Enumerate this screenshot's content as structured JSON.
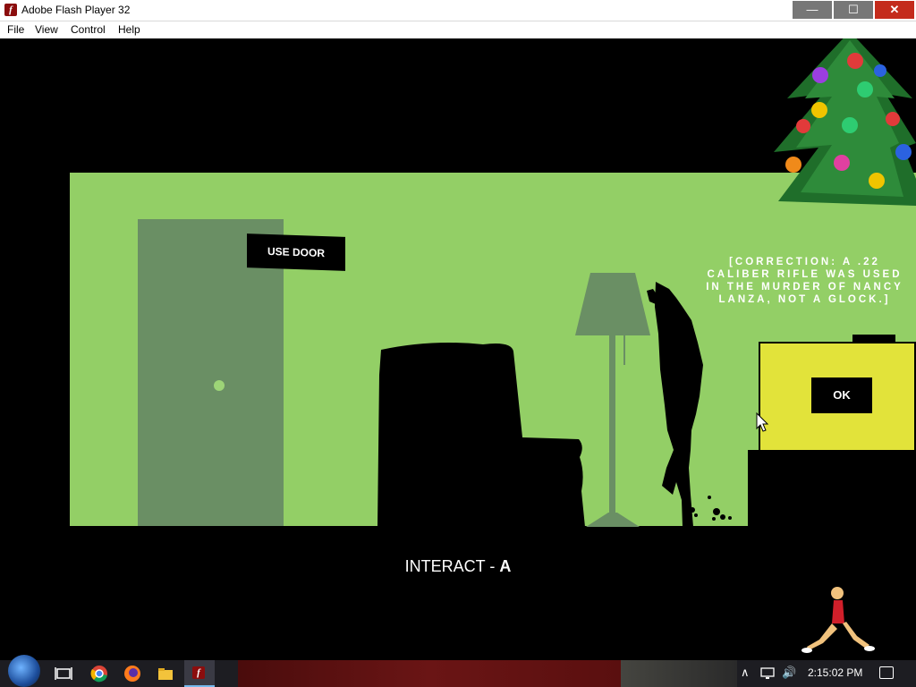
{
  "window": {
    "title": "Adobe Flash Player 32",
    "minimize": "—",
    "maximize": "☐",
    "close": "✕"
  },
  "menu": {
    "file": "File",
    "view": "View",
    "control": "Control",
    "help": "Help"
  },
  "game": {
    "use_door_label": "USE DOOR",
    "correction_text": "[CORRECTION: A .22 CALIBER RIFLE WAS USED IN THE MURDER OF NANCY LANZA, NOT A GLOCK.]",
    "ok_label": "OK",
    "interact_prefix": "INTERACT - ",
    "interact_key": "A"
  },
  "taskbar": {
    "time": "2:15:02 PM",
    "pinned": [
      "task-view-icon",
      "chrome-icon",
      "firefox-icon",
      "file-explorer-icon",
      "flash-player-icon"
    ],
    "tray_chevron": "∧",
    "volume": "🔊"
  },
  "colors": {
    "room": "#93cf66",
    "door": "#6a8f64",
    "tv": "#e2e33a",
    "close": "#c42b1c"
  }
}
